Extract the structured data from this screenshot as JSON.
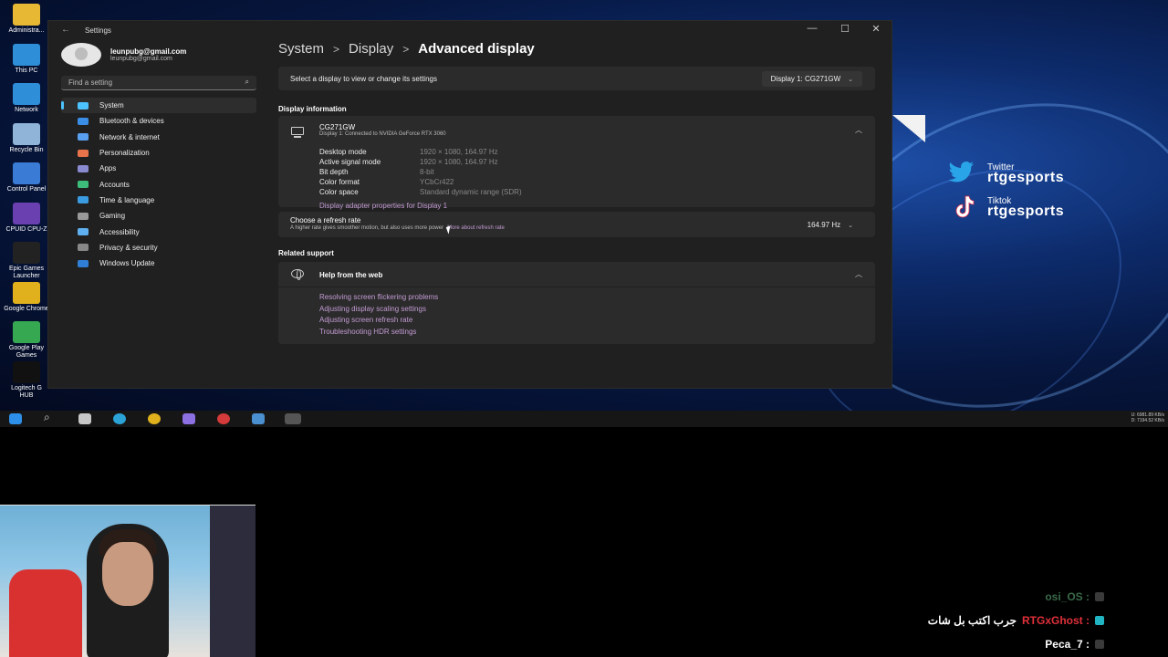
{
  "desktop": {
    "icons": [
      {
        "label": "Administra...",
        "color": "#e7b833"
      },
      {
        "label": "This PC",
        "color": "#2e8fd8"
      },
      {
        "label": "Network",
        "color": "#2e8fd8"
      },
      {
        "label": "Recycle Bin",
        "color": "#8fb4d8"
      },
      {
        "label": "Control Panel",
        "color": "#3a7bd5"
      },
      {
        "label": "CPUID CPU-Z",
        "color": "#6a3fb0"
      },
      {
        "label": "Epic Games Launcher",
        "color": "#222222"
      },
      {
        "label": "Google Chrome",
        "color": "#e0b11d"
      },
      {
        "label": "Google Play Games",
        "color": "#36a852"
      },
      {
        "label": "Logitech G HUB",
        "color": "#111111"
      }
    ]
  },
  "social": {
    "twitter_platform": "Twitter",
    "twitter_handle": "rtgesports",
    "tiktok_platform": "Tiktok",
    "tiktok_handle": "rtgesports"
  },
  "window": {
    "title": "Settings",
    "back_icon": "arrow-left-icon",
    "controls": {
      "minimize": "—",
      "maximize": "☐",
      "close": "✕"
    }
  },
  "profile": {
    "name": "leunpubg@gmail.com",
    "email": "leunpubg@gmail.com"
  },
  "search": {
    "placeholder": "Find a setting",
    "icon": "search-icon"
  },
  "nav": [
    {
      "label": "System",
      "active": true,
      "color": "#4cc2ff"
    },
    {
      "label": "Bluetooth & devices",
      "active": false,
      "color": "#3a8ee6"
    },
    {
      "label": "Network & internet",
      "active": false,
      "color": "#5aa0f0"
    },
    {
      "label": "Personalization",
      "active": false,
      "color": "#e8734a"
    },
    {
      "label": "Apps",
      "active": false,
      "color": "#8a8ad0"
    },
    {
      "label": "Accounts",
      "active": false,
      "color": "#3dbd7a"
    },
    {
      "label": "Time & language",
      "active": false,
      "color": "#3a9be0"
    },
    {
      "label": "Gaming",
      "active": false,
      "color": "#999999"
    },
    {
      "label": "Accessibility",
      "active": false,
      "color": "#5eb0f0"
    },
    {
      "label": "Privacy & security",
      "active": false,
      "color": "#888888"
    },
    {
      "label": "Windows Update",
      "active": false,
      "color": "#2f7fd6"
    }
  ],
  "breadcrumb": {
    "part1": "System",
    "part2": "Display",
    "current": "Advanced display",
    "separator": ">"
  },
  "select_display": {
    "label": "Select a display to view or change its settings",
    "value": "Display 1: CG271GW"
  },
  "display_info": {
    "section_label": "Display information",
    "name": "CG271GW",
    "subtitle": "Display 1: Connected to NVIDIA GeForce RTX 3060",
    "rows": [
      {
        "k": "Desktop mode",
        "v": "1920 × 1080, 164.97 Hz"
      },
      {
        "k": "Active signal mode",
        "v": "1920 × 1080, 164.97 Hz"
      },
      {
        "k": "Bit depth",
        "v": "8-bit"
      },
      {
        "k": "Color format",
        "v": "YCbCr422"
      },
      {
        "k": "Color space",
        "v": "Standard dynamic range (SDR)"
      }
    ],
    "adapter_link": "Display adapter properties for Display 1"
  },
  "refresh": {
    "title": "Choose a refresh rate",
    "desc": "A higher rate gives smoother motion, but also uses more power",
    "link": "More about refresh rate",
    "value": "164.97 Hz"
  },
  "related": {
    "section_label": "Related support",
    "help_title": "Help from the web",
    "links": [
      "Resolving screen flickering problems",
      "Adjusting display scaling settings",
      "Adjusting screen refresh rate",
      "Troubleshooting HDR settings"
    ]
  },
  "taskbar": {
    "tray_line1": "U: 6981.89 KB/s",
    "tray_line2": "D: 7194.52 KB/s"
  },
  "chat": [
    {
      "user": "osi_OS :",
      "msg": "",
      "color": "#3a6a4a"
    },
    {
      "user": "RTGxGhost :",
      "msg": "جرب اكتب بل شات",
      "color": "#e0303a"
    },
    {
      "user": "Peca_7 :",
      "msg": "",
      "color": "#ffffff"
    }
  ]
}
